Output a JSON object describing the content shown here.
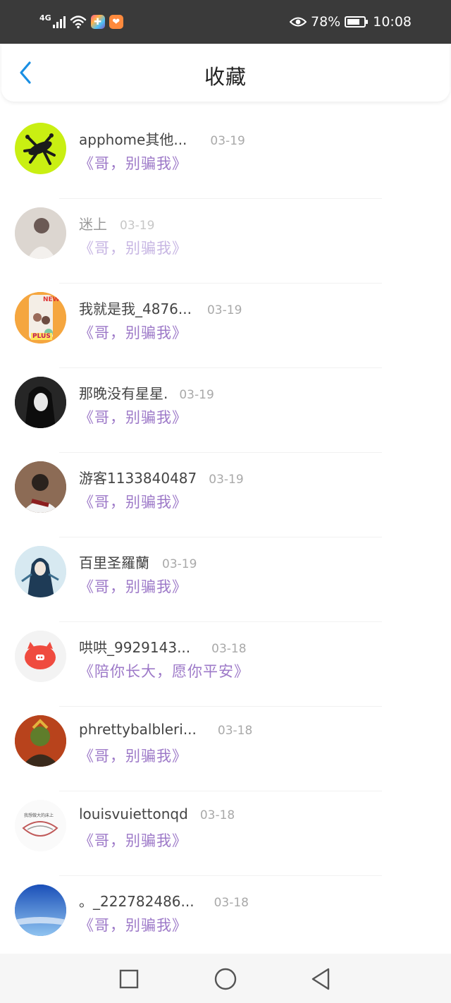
{
  "status_bar": {
    "network": "4G",
    "battery_percent": "78%",
    "battery_level": 0.78,
    "time": "10:08",
    "icons": [
      "signal-icon",
      "wifi-icon",
      "app-icon-plus",
      "app-icon-heart",
      "eye-icon",
      "battery-icon"
    ]
  },
  "header": {
    "title": "收藏",
    "back_icon": "chevron-left-icon"
  },
  "favorites": [
    {
      "name": "apphome其他...",
      "date": "03-19",
      "song": "《哥，别骗我》",
      "faded": false
    },
    {
      "name": "迷上",
      "date": "03-19",
      "song": "《哥，别骗我》",
      "faded": true
    },
    {
      "name": "我就是我_4876...",
      "date": "03-19",
      "song": "《哥，别骗我》",
      "faded": false
    },
    {
      "name": "那晚没有星星.",
      "date": "03-19",
      "song": "《哥，别骗我》",
      "faded": false
    },
    {
      "name": "游客1133840487",
      "date": "03-19",
      "song": "《哥，别骗我》",
      "faded": false
    },
    {
      "name": "百里圣羅蘭",
      "date": "03-19",
      "song": "《哥，别骗我》",
      "faded": false
    },
    {
      "name": "哄哄_9929143...",
      "date": "03-18",
      "song": "《陪你长大，愿你平安》",
      "faded": false
    },
    {
      "name": "phrettybalbleri...",
      "date": "03-18",
      "song": "《哥，别骗我》",
      "faded": false
    },
    {
      "name": "louisvuiettonqd",
      "date": "03-18",
      "song": "《哥，别骗我》",
      "faded": false
    },
    {
      "name": "。_222782486...",
      "date": "03-18",
      "song": "《哥，别骗我》",
      "faded": false
    }
  ],
  "avatar_text": {
    "new_badge": "NEW",
    "plus_badge": "PLUS",
    "caption": "我想做大的床上"
  },
  "colors": {
    "status_bar_bg": "#3a3a3a",
    "accent_blue": "#1a8fe3",
    "song_purple": "#9d79c8",
    "date_gray": "#a9a9a9",
    "nav_bg": "#f6f6f6"
  },
  "nav_bar": {
    "icons": [
      "recent-apps-icon",
      "home-icon",
      "back-triangle-icon"
    ]
  }
}
